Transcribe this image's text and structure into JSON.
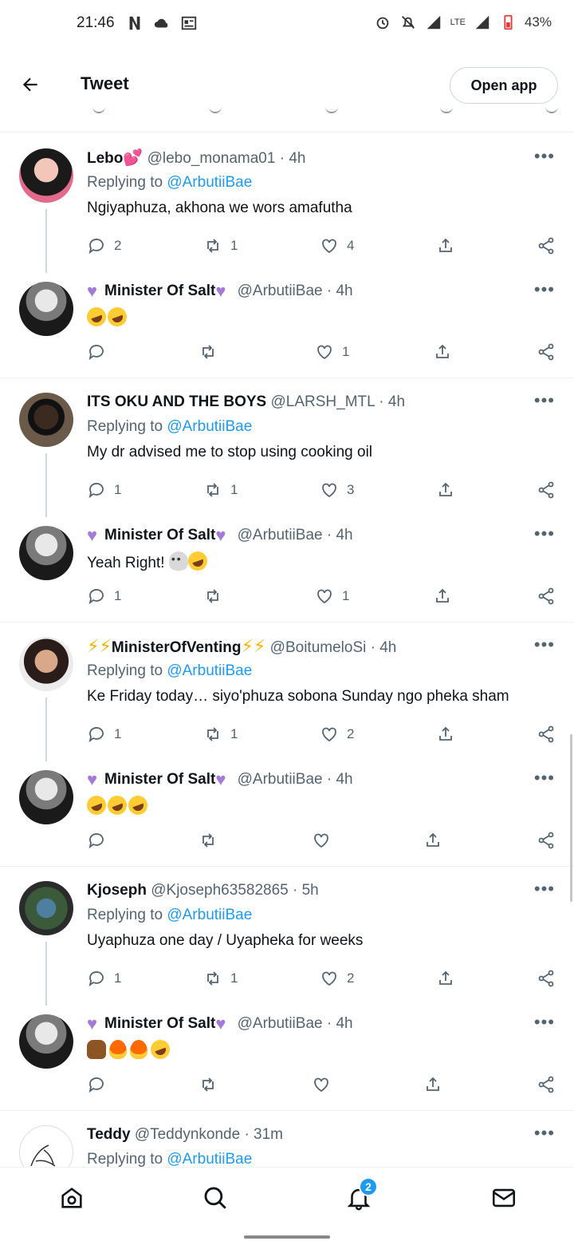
{
  "status_bar": {
    "time": "21:46",
    "battery": "43%",
    "network": "LTE",
    "icons_left": [
      "netflix-icon",
      "cloud-icon",
      "news-icon"
    ],
    "icons_right": [
      "alarm-icon",
      "mute-icon",
      "signal-icon",
      "signal-icon",
      "battery-icon"
    ]
  },
  "header": {
    "title": "Tweet",
    "open_app_label": "Open app"
  },
  "threads": [
    {
      "tweet": {
        "name": "Lebo",
        "name_suffix": "💕",
        "handle": "@lebo_monama01",
        "time": "4h",
        "replying_to_label": "Replying to",
        "replying_to": "@ArbutiiBae",
        "text": "Ngiyaphuza, akhona we wors amafutha",
        "reply_count": "2",
        "retweet_count": "1",
        "like_count": "4"
      },
      "reply": {
        "name": "Minister Of Salt",
        "handle": "@ArbutiiBae",
        "time": "4h",
        "text": "",
        "emojis": [
          "laugh",
          "laugh"
        ],
        "reply_count": "",
        "retweet_count": "",
        "like_count": "1"
      }
    },
    {
      "tweet": {
        "name": "ITS OKU AND THE BOYS",
        "name_suffix": "",
        "handle": "@LARSH_MTL",
        "time": "4h",
        "replying_to_label": "Replying to",
        "replying_to": "@ArbutiiBae",
        "text": "My dr advised me to stop using cooking oil",
        "reply_count": "1",
        "retweet_count": "1",
        "like_count": "3"
      },
      "reply": {
        "name": "Minister Of Salt",
        "handle": "@ArbutiiBae",
        "time": "4h",
        "text": "Yeah Right!",
        "emojis": [
          "skull",
          "laugh"
        ],
        "reply_count": "1",
        "retweet_count": "",
        "like_count": "1"
      }
    },
    {
      "tweet": {
        "name": "MinisterOfVenting",
        "name_suffix": "",
        "handle": "@BoitumeloSi",
        "time": "4h",
        "replying_to_label": "Replying to",
        "replying_to": "@ArbutiiBae",
        "text": "Ke Friday today… siyo'phuza sobona Sunday ngo pheka sham",
        "reply_count": "1",
        "retweet_count": "1",
        "like_count": "2"
      },
      "reply": {
        "name": "Minister Of Salt",
        "handle": "@ArbutiiBae",
        "time": "4h",
        "text": "",
        "emojis": [
          "laugh",
          "laugh",
          "laugh"
        ],
        "reply_count": "",
        "retweet_count": "",
        "like_count": ""
      }
    },
    {
      "tweet": {
        "name": "Kjoseph",
        "name_suffix": "",
        "handle": "@Kjoseph63582865",
        "time": "5h",
        "replying_to_label": "Replying to",
        "replying_to": "@ArbutiiBae",
        "text": "Uyaphuza one day / Uyapheka for weeks",
        "reply_count": "1",
        "retweet_count": "1",
        "like_count": "2"
      },
      "reply": {
        "name": "Minister Of Salt",
        "handle": "@ArbutiiBae",
        "time": "4h",
        "text": "",
        "emojis": [
          "hands",
          "fire",
          "fire",
          "laugh"
        ],
        "reply_count": "",
        "retweet_count": "",
        "like_count": ""
      }
    }
  ],
  "last_tweet": {
    "name": "Teddy",
    "handle": "@Teddynkonde",
    "time": "31m",
    "replying_to_label": "Replying to",
    "replying_to": "@ArbutiiBae"
  },
  "bottom_nav": {
    "notification_badge": "2",
    "items": [
      "home-icon",
      "search-icon",
      "notifications-icon",
      "messages-icon"
    ]
  },
  "colors": {
    "accent": "#1d9bf0",
    "secondary_text": "#536471",
    "primary_text": "#0f1419"
  }
}
